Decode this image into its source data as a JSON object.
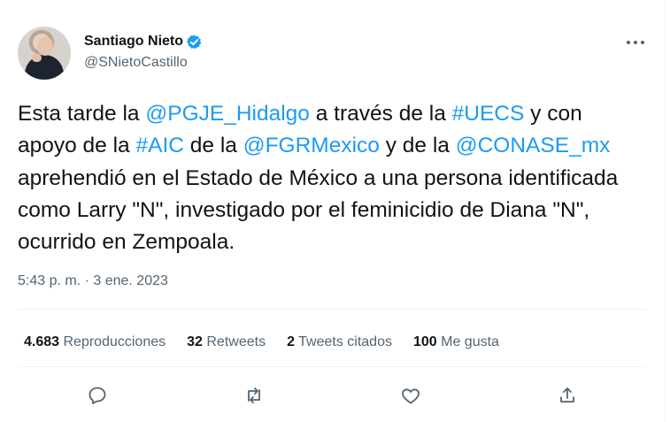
{
  "author": {
    "name": "Santiago Nieto",
    "handle": "@SNietoCastillo",
    "verified_icon": "verified-badge-icon",
    "avatar_icon": "avatar"
  },
  "more_icon": "more-icon",
  "tweet": {
    "parts": [
      {
        "text": "Esta tarde la ",
        "type": "text"
      },
      {
        "text": "@PGJE_Hidalgo",
        "type": "mention"
      },
      {
        "text": " a través de la ",
        "type": "text"
      },
      {
        "text": "#UECS",
        "type": "hashtag"
      },
      {
        "text": " y con apoyo de la ",
        "type": "text"
      },
      {
        "text": "#AIC",
        "type": "hashtag"
      },
      {
        "text": " de la ",
        "type": "text"
      },
      {
        "text": "@FGRMexico",
        "type": "mention"
      },
      {
        "text": " y de la ",
        "type": "text"
      },
      {
        "text": "@CONASE_mx",
        "type": "mention"
      },
      {
        "text": " aprehendió en el Estado de México a una persona identificada como Larry \"N\", investigado por el feminicidio de Diana \"N\", ocurrido en Zempoala.",
        "type": "text"
      }
    ],
    "timestamp": "5:43 p. m. · 3 ene. 2023"
  },
  "stats": {
    "views_count": "4.683",
    "views_label": "Reproducciones",
    "retweets_count": "32",
    "retweets_label": "Retweets",
    "quotes_count": "2",
    "quotes_label": "Tweets citados",
    "likes_count": "100",
    "likes_label": "Me gusta"
  },
  "actions": [
    "reply-icon",
    "retweet-icon",
    "like-icon",
    "share-icon"
  ],
  "colors": {
    "link": "#1d9bf0",
    "text": "#0f1419",
    "muted": "#536471",
    "divider": "#eff3f4"
  }
}
